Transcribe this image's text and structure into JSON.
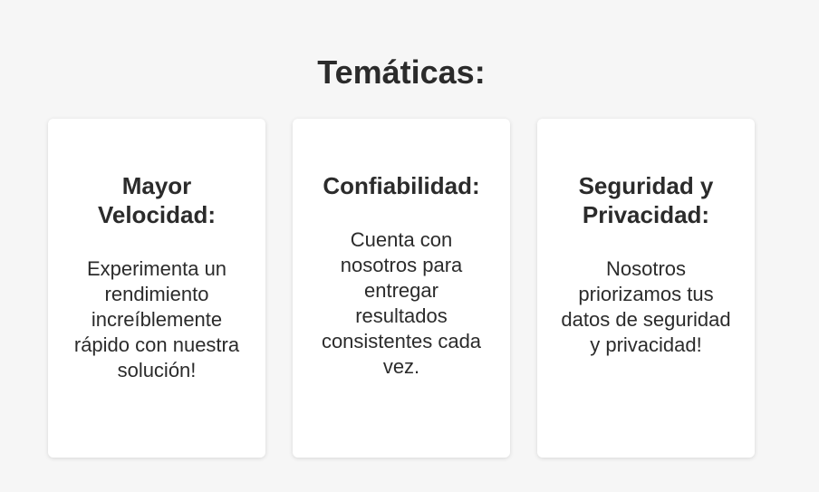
{
  "section": {
    "title": "Temáticas:"
  },
  "cards": [
    {
      "title": "Mayor Velocidad:",
      "text": "Experimenta un rendimiento increíblemente rápido con nuestra solución!"
    },
    {
      "title": "Confiabilidad:",
      "text": "Cuenta con nosotros para entregar resultados consistentes cada vez."
    },
    {
      "title": "Seguridad y Privacidad:",
      "text": "Nosotros priorizamos tus datos de seguridad y privacidad!"
    }
  ]
}
